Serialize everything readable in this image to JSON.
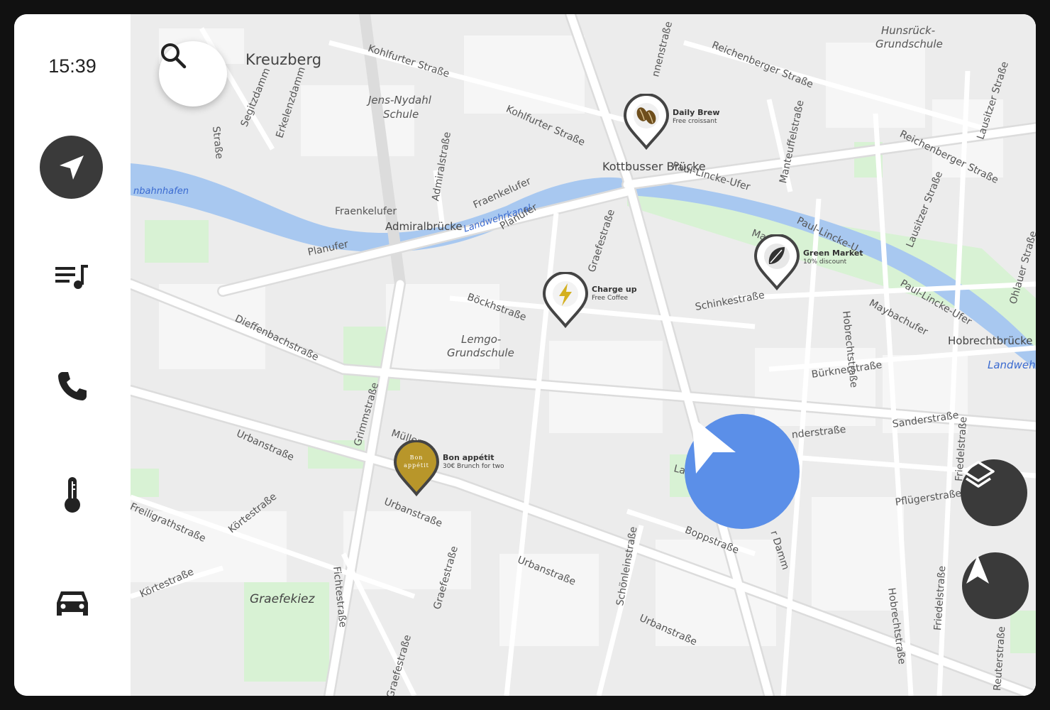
{
  "clock": "15:39",
  "sidebar": {
    "items": [
      {
        "icon": "navigation-arrow-icon",
        "active": true
      },
      {
        "icon": "playlist-icon"
      },
      {
        "icon": "phone-icon"
      },
      {
        "icon": "thermometer-icon"
      },
      {
        "icon": "car-icon"
      }
    ]
  },
  "map": {
    "district": "Kreuzberg",
    "neighborhood": "Graefekiez",
    "bridge": "Kottbusser Brücke",
    "labels": {
      "jens_nydahl_1": "Jens-Nydahl",
      "jens_nydahl_2": "Schule",
      "hunsrueck_1": "Hunsrück-",
      "hunsrueck_2": "Grundschule",
      "lemgo_1": "Lemgo-",
      "lemgo_2": "Grundschule",
      "admiralbruecke": "Admiralbrücke",
      "hobrechtbruecke": "Hobrechtbrücke",
      "landwehrkanal": "Landwehrkanal",
      "landwehr_right": "Landwehr",
      "bahnhafen": "nbahnhafen",
      "kohlfurter1": "Kohlfurter Straße",
      "kohlfurter2": "Kohlfurter Straße",
      "reichenberger1": "Reichenberger Straße",
      "reichenberger2": "Reichenberger Straße",
      "fraenkelufer1": "Fraenkelufer",
      "fraenkelufer2": "Fraenkelufer",
      "planufer1": "Planufer",
      "planufer2": "Planufer",
      "paul_lincke1": "Paul-Lincke-Ufer",
      "paul_lincke2": "Paul-Lincke-Ufer",
      "paul_lincke3": "Paul-Lincke-U",
      "maybachufer": "Maybachufer",
      "maybach_top": "Mayb",
      "admiralstrasse": "Admiralstraße",
      "graefestrasse1": "Graefestraße",
      "graefestrasse2": "Graefestraße",
      "graefestrasse3": "Graefestraße",
      "boeckhstrasse": "Böckhstraße",
      "dieffenbach": "Dieffenbachstraße",
      "urban1": "Urbanstraße",
      "urban2": "Urbanstraße",
      "urban3": "Urbanstraße",
      "urban4": "Urbanstraße",
      "grimm": "Grimmstraße",
      "mueller": "Müller",
      "schinke": "Schinkestraße",
      "buerkner": "Bürknerstraße",
      "sander1": "Sanderstraße",
      "sander2": "nderstraße",
      "pflueger": "Pflügerstraße",
      "lachmann": "Lach",
      "boppstrasse": "Boppstraße",
      "kottbusser_damm": "r Damm",
      "schoenlein": "Schönleinstraße",
      "manteuffel": "Manteuffelstraße",
      "lausitzer1": "Lausitzer Straße",
      "lausitzer2": "Lausitzer Straße",
      "ohlauer": "Ohlauer Straße",
      "hobrecht1": "Hobrechtstraße",
      "hobrecht2": "Hobrechtstraße",
      "friedel1": "Friedelstraße",
      "friedel2": "Friedelstraße",
      "reuter": "Reuterstraße",
      "fichte": "Fichtestraße",
      "koerte1": "Körtestraße",
      "koerte2": "Körtestraße",
      "freiligrath": "Freiligrathstraße",
      "segitzdamm": "Segitzdamm",
      "erkelenz": "Erkelenzdamm",
      "strasse_top": "Straße",
      "mannen": "nnenstraße"
    }
  },
  "pois": [
    {
      "title": "Daily Brew",
      "subtitle": "Free croissant",
      "icon": "coffee-beans-icon"
    },
    {
      "title": "Green Market",
      "subtitle": "10% discount",
      "icon": "leaf-icon"
    },
    {
      "title": "Charge up",
      "subtitle": "Free Coffee",
      "icon": "lightning-icon"
    },
    {
      "title": "Bon appétit",
      "subtitle": "30€ Brunch for two",
      "logo_line1": "Bon",
      "logo_line2": "appétit",
      "icon": "restaurant-logo"
    }
  ],
  "colors": {
    "water": "#a8c8f0",
    "park": "#d8f2d4",
    "road": "#ffffff",
    "accent_blue": "#5b8fe8",
    "dark_button": "#3a3a3a",
    "pin_gold": "#b8962a"
  },
  "buttons": {
    "search_icon": "search-icon",
    "layers_icon": "layers-icon",
    "recenter_icon": "north-arrow-icon"
  }
}
